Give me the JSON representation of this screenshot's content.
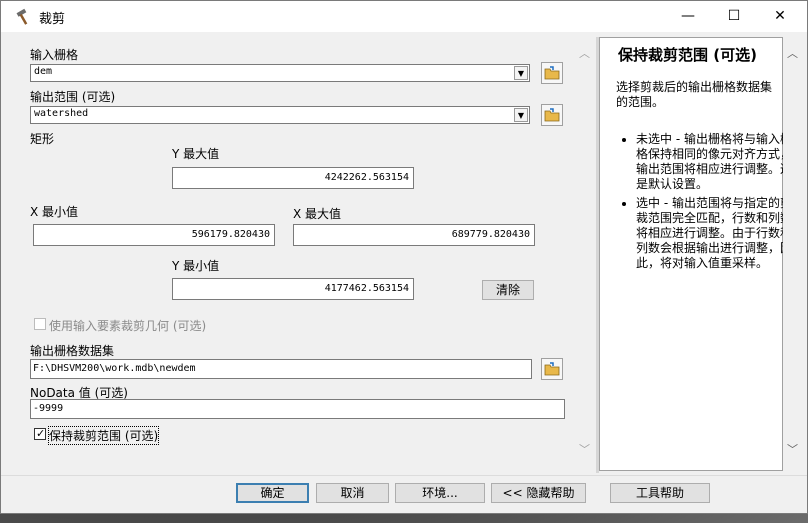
{
  "window": {
    "title": "裁剪",
    "icon": "hammer-icon",
    "controls": {
      "minimize": "—",
      "maximize": "☐",
      "close": "✕"
    }
  },
  "form": {
    "input_raster": {
      "label": "输入栅格",
      "value": "dem"
    },
    "output_extent": {
      "label": "输出范围 (可选)",
      "value": "watershed"
    },
    "rectangle": {
      "label": "矩形",
      "y_max": {
        "label": "Y 最大值",
        "value": "4242262.563154"
      },
      "x_min": {
        "label": "X 最小值",
        "value": "596179.820430"
      },
      "x_max": {
        "label": "X 最大值",
        "value": "689779.820430"
      },
      "y_min": {
        "label": "Y 最小值",
        "value": "4177462.563154"
      },
      "clear_label": "清除"
    },
    "use_input_features": {
      "label": "使用输入要素裁剪几何 (可选)",
      "checked": false
    },
    "output_raster": {
      "label": "输出栅格数据集",
      "value": "F:\\DHSVM200\\work.mdb\\newdem"
    },
    "nodata": {
      "label": "NoData 值 (可选)",
      "value": "-9999"
    },
    "maintain_extent": {
      "label": "保持裁剪范围 (可选)",
      "checked": true
    }
  },
  "help": {
    "title": "保持裁剪范围 (可选)",
    "intro": "选择剪裁后的输出栅格数据集的范围。",
    "items": [
      "未选中 - 输出栅格将与输入栅格保持相同的像元对齐方式，输出范围将相应进行调整。这是默认设置。",
      "选中 - 输出范围将与指定的剪裁范围完全匹配，行数和列数将相应进行调整。由于行数和列数会根据输出进行调整，因此，将对输入值重采样。"
    ]
  },
  "buttons": {
    "ok": "确定",
    "cancel": "取消",
    "environments": "环境...",
    "hide_help": "<< 隐藏帮助",
    "tool_help": "工具帮助"
  }
}
